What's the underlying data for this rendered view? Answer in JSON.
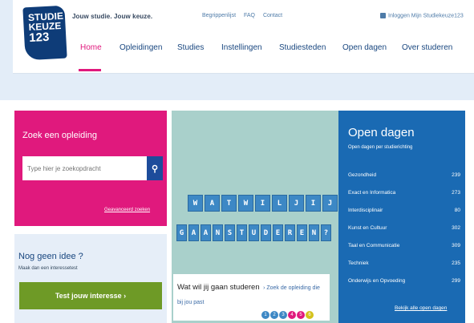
{
  "header": {
    "logo_lines": [
      "STUDIE",
      "KEUZE",
      "123"
    ],
    "tagline": "Jouw studie. Jouw keuze.",
    "top_links": [
      "Begrippenlijst",
      "FAQ",
      "Contact"
    ],
    "login": "Inloggen Mijn Studiekeuze123"
  },
  "nav": {
    "items": [
      "Home",
      "Opleidingen",
      "Studies",
      "Instellingen",
      "Studiesteden",
      "Open dagen",
      "Over studeren"
    ],
    "active": "Home"
  },
  "search": {
    "title": "Zoek een opleiding",
    "placeholder": "Type hier je zoekopdracht",
    "advanced_link": "Geavanceerd zoeken"
  },
  "idee": {
    "title": "Nog geen idee ?",
    "subtitle": "Maak dan een interessetest",
    "button": "Test jouw interesse ›"
  },
  "banner": {
    "row1": [
      "W",
      "A",
      "T",
      "W",
      "I",
      "L",
      "J",
      "I",
      "J"
    ],
    "row2": [
      "G",
      "A",
      "A",
      "N",
      "S",
      "T",
      "U",
      "D",
      "E",
      "R",
      "E",
      "N",
      "?"
    ],
    "caption_title": "Wat wil jij gaan studeren",
    "caption_link": "› Zoek de opleiding die bij jou past",
    "dots": [
      "1",
      "2",
      "3",
      "4",
      "5",
      "6"
    ]
  },
  "open_dagen": {
    "title": "Open dagen",
    "subtitle": "Open dagen per studierichting",
    "rows": [
      {
        "label": "Gezondheid",
        "count": "239"
      },
      {
        "label": "Exact en Informatica",
        "count": "273"
      },
      {
        "label": "Interdisciplinair",
        "count": "80"
      },
      {
        "label": "Kunst en Cultuur",
        "count": "302"
      },
      {
        "label": "Taal en Communicatie",
        "count": "309"
      },
      {
        "label": "Techniek",
        "count": "235"
      },
      {
        "label": "Onderwijs en Opvoeding",
        "count": "299"
      }
    ],
    "all_link": "Bekijk alle open dagen"
  },
  "colors": {
    "pink": "#e0197d",
    "navy": "#0e3c78",
    "blue": "#1a6ab3",
    "green": "#6e9a26",
    "teal": "#a9d0cb"
  }
}
